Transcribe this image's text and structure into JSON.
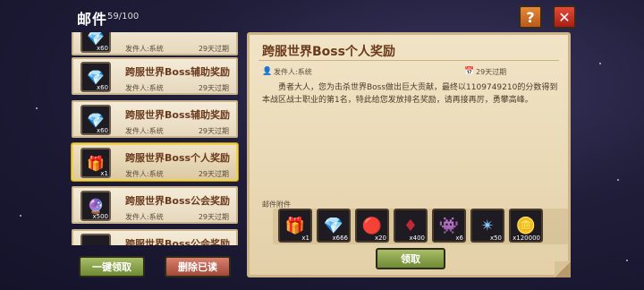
{
  "header": {
    "title": "邮件",
    "count": "59/100",
    "help_label": "?",
    "close_label": "✕"
  },
  "mail_list": [
    {
      "title": "",
      "sender": "发件人:系统",
      "expiry": "29天过期",
      "qty": "x60",
      "icon": "diamond-icon",
      "glyph": "💎",
      "selected": false
    },
    {
      "title": "跨服世界Boss辅助奖励",
      "sender": "发件人:系统",
      "expiry": "29天过期",
      "qty": "x60",
      "icon": "diamond-icon",
      "glyph": "💎",
      "selected": false
    },
    {
      "title": "跨服世界Boss辅助奖励",
      "sender": "发件人:系统",
      "expiry": "29天过期",
      "qty": "x60",
      "icon": "diamond-icon",
      "glyph": "💎",
      "selected": false
    },
    {
      "title": "跨服世界Boss个人奖励",
      "sender": "发件人:系统",
      "expiry": "29天过期",
      "qty": "x1",
      "icon": "treasure-chest-icon",
      "glyph": "🎁",
      "selected": true
    },
    {
      "title": "跨服世界Boss公会奖励",
      "sender": "发件人:系统",
      "expiry": "29天过期",
      "qty": "x500",
      "icon": "purple-flame-icon",
      "glyph": "🔮",
      "selected": false
    },
    {
      "title": "跨服世界Boss公会奖励",
      "sender": "",
      "expiry": "",
      "qty": "",
      "icon": "item-icon",
      "glyph": "",
      "selected": false
    }
  ],
  "buttons": {
    "collect_all": "一键领取",
    "delete_read": "删除已读",
    "claim": "领取"
  },
  "detail": {
    "title": "跨服世界Boss个人奖励",
    "sender": "发件人:系统",
    "expiry": "29天过期",
    "body": "勇者大人，您为击杀世界Boss做出巨大贡献，最终以1109749210的分数得到本战区战士职业的第1名，特此给您发放排名奖励，请再接再厉，勇攀高峰。",
    "attachments_label": "邮件附件",
    "attachments": [
      {
        "icon": "treasure-chest-icon",
        "glyph": "🎁",
        "qty": "x1"
      },
      {
        "icon": "diamond-icon",
        "glyph": "💎",
        "qty": "x666"
      },
      {
        "icon": "red-gem-cluster-icon",
        "glyph": "🔴",
        "qty": "x20"
      },
      {
        "icon": "red-crystal-icon",
        "glyph": "♦",
        "qty": "x400"
      },
      {
        "icon": "purple-demon-icon",
        "glyph": "👾",
        "qty": "x6"
      },
      {
        "icon": "blue-star-crystal-icon",
        "glyph": "✴",
        "qty": "x50"
      },
      {
        "icon": "gold-coin-icon",
        "glyph": "🪙",
        "qty": "x120000"
      }
    ]
  },
  "colors": {
    "title_brown": "#6b3a1c",
    "green_button": "#8aa24a",
    "red_button": "#c06050",
    "parchment": "#efe2c4"
  }
}
